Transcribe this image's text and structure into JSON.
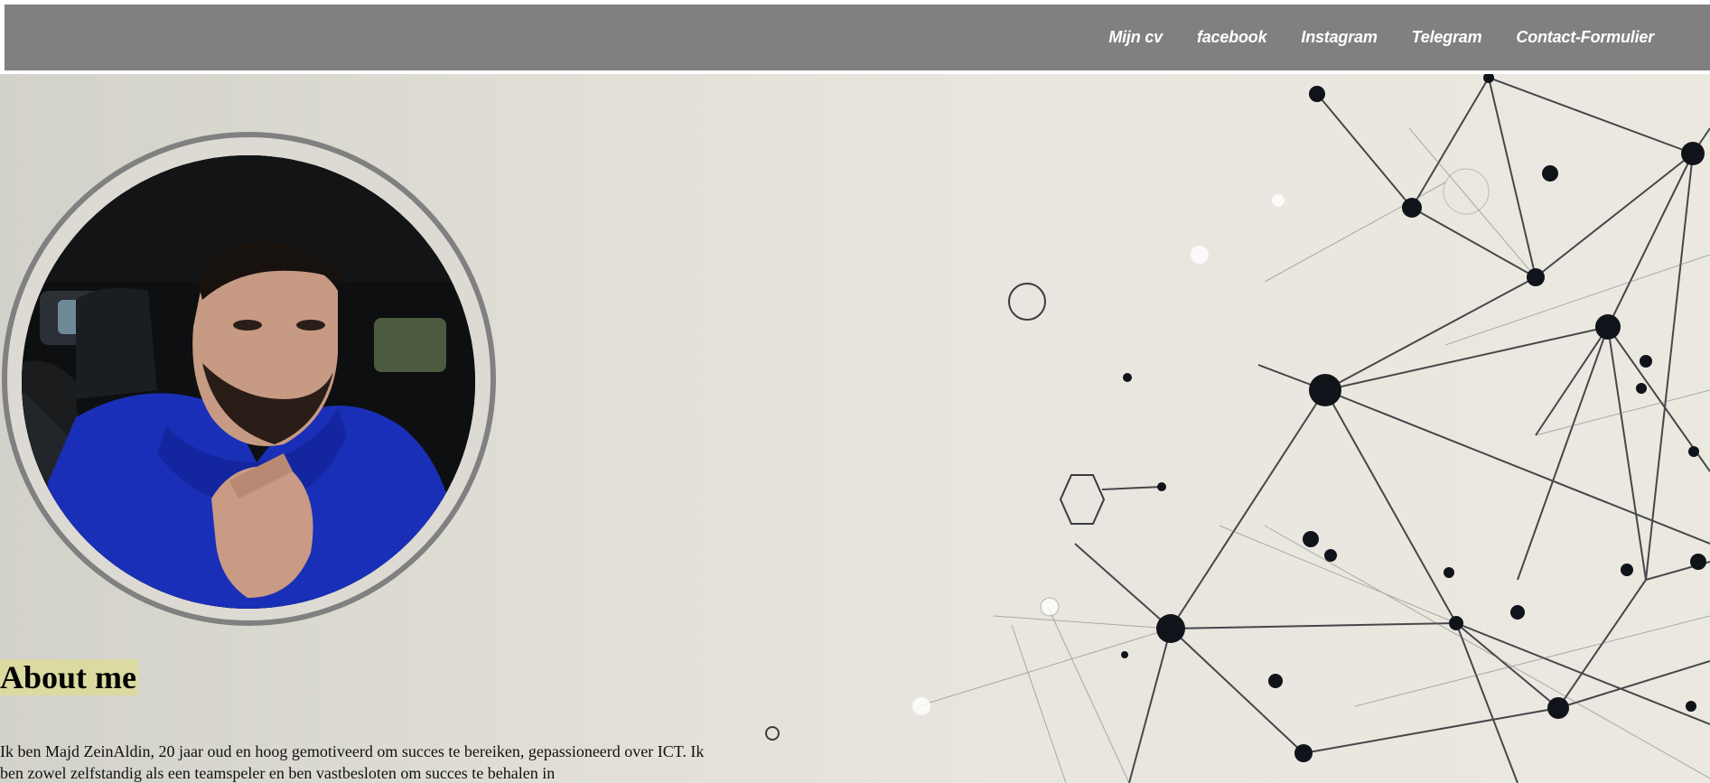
{
  "nav": {
    "items": [
      {
        "label": "Mijn cv"
      },
      {
        "label": "facebook"
      },
      {
        "label": "Instagram"
      },
      {
        "label": "Telegram"
      },
      {
        "label": "Contact-Formulier"
      }
    ]
  },
  "about": {
    "title": "About me",
    "text": "Ik ben Majd ZeinAldin, 20 jaar oud en hoog gemotiveerd om succes te bereiken, gepassioneerd over ICT. Ik ben zowel zelfstandig als een teamspeler en ben vastbesloten om succes te behalen in"
  },
  "colors": {
    "navbar": "#808080",
    "title_highlight": "#dbdaa0"
  }
}
